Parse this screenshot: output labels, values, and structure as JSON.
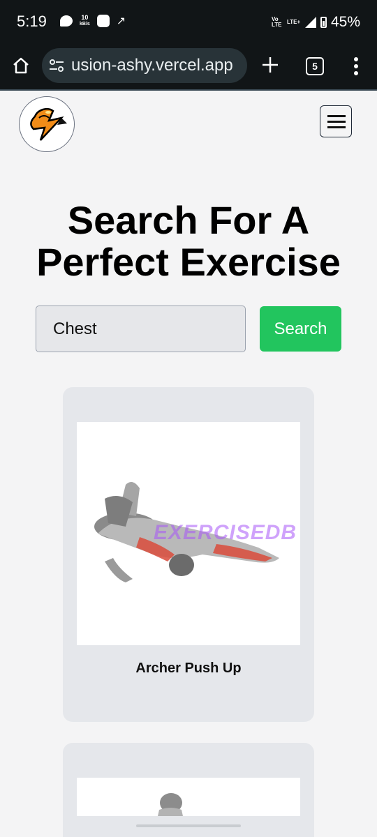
{
  "status_bar": {
    "time": "5:19",
    "speed_value": "10",
    "speed_unit": "kB/s",
    "network_left": "Vo LTE",
    "network_right": "LTE+",
    "battery": "45%"
  },
  "browser": {
    "url": "usion-ashy.vercel.app",
    "tab_count": "5"
  },
  "header": {
    "logo_icon": "muscle-arm-logo",
    "menu_icon": "hamburger-icon"
  },
  "main": {
    "title_line1": "Search For A",
    "title_line2": "Perfect Exercise",
    "search": {
      "value": "Chest",
      "button_label": "Search"
    },
    "exercises": [
      {
        "name": "Archer Push Up",
        "watermark": "EXERCISEDB"
      },
      {
        "name": "",
        "watermark": ""
      }
    ]
  },
  "colors": {
    "accent_green": "#22c55e",
    "card_bg": "#e5e7eb",
    "page_bg": "#f4f4f5",
    "chrome_dark": "#111517"
  }
}
